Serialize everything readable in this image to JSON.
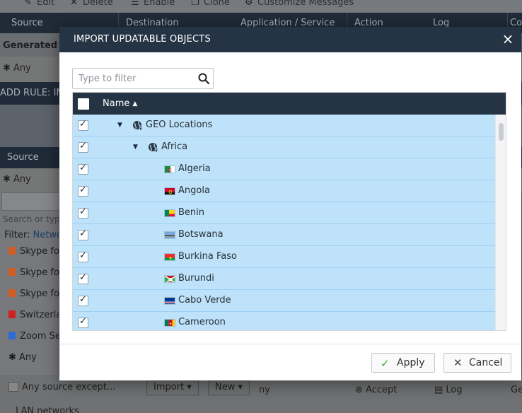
{
  "background": {
    "toolbar": [
      {
        "icon": "edit-icon",
        "label": "Edit"
      },
      {
        "icon": "delete-icon",
        "label": "Delete"
      },
      {
        "icon": "enable-icon",
        "label": "Enable"
      },
      {
        "icon": "clone-icon",
        "label": "Clone"
      },
      {
        "icon": "gear-icon",
        "label": "Customize Messages"
      }
    ],
    "columns": [
      "Source",
      "Destination",
      "Application / Service",
      "Action",
      "Log",
      "Co"
    ],
    "generated_rules_label": "Generated Ru",
    "any_label": "Any",
    "add_rule_label": "ADD RULE: IN",
    "source_header": "Source",
    "panel": {
      "search_placeholder": "Search or type",
      "filter_label": "Filter:",
      "filter_value": "Netwo",
      "items": [
        {
          "label": "Skype for",
          "color": "#d45b22"
        },
        {
          "label": "Skype for",
          "color": "#d45b22"
        },
        {
          "label": "Skype for",
          "color": "#d45b22"
        },
        {
          "label": "Switzerla",
          "color": "#d0211e"
        },
        {
          "label": "Zoom Se",
          "color": "#2d6bd6"
        },
        {
          "label": "Any",
          "color": ""
        }
      ]
    },
    "bottom": {
      "any_source_except": "Any source except...",
      "import_button": "Import ▾",
      "new_button": "New ▾",
      "cells": [
        "ny",
        "Accept",
        "Log",
        "Ge"
      ],
      "lan_label": "LAN networks"
    }
  },
  "dialog": {
    "title": "IMPORT UPDATABLE OBJECTS",
    "close_glyph": "×",
    "filter_placeholder": "Type to filter",
    "column_name": "Name",
    "sort_glyph": "▲",
    "rows": [
      {
        "label": "GEO Locations",
        "checked": true,
        "level": 0,
        "kind": "folder",
        "expanded": true
      },
      {
        "label": "Africa",
        "checked": true,
        "level": 1,
        "kind": "folder",
        "expanded": true
      },
      {
        "label": "Algeria",
        "checked": true,
        "level": 2,
        "kind": "flag",
        "flag": "algeria"
      },
      {
        "label": "Angola",
        "checked": true,
        "level": 2,
        "kind": "flag",
        "flag": "angola"
      },
      {
        "label": "Benin",
        "checked": true,
        "level": 2,
        "kind": "flag",
        "flag": "benin"
      },
      {
        "label": "Botswana",
        "checked": true,
        "level": 2,
        "kind": "flag",
        "flag": "botswana"
      },
      {
        "label": "Burkina Faso",
        "checked": true,
        "level": 2,
        "kind": "flag",
        "flag": "burkina"
      },
      {
        "label": "Burundi",
        "checked": true,
        "level": 2,
        "kind": "flag",
        "flag": "burundi"
      },
      {
        "label": "Cabo Verde",
        "checked": true,
        "level": 2,
        "kind": "flag",
        "flag": "caboverde"
      },
      {
        "label": "Cameroon",
        "checked": true,
        "level": 2,
        "kind": "flag",
        "flag": "cameroon"
      }
    ],
    "apply_label": "Apply",
    "cancel_label": "Cancel"
  }
}
